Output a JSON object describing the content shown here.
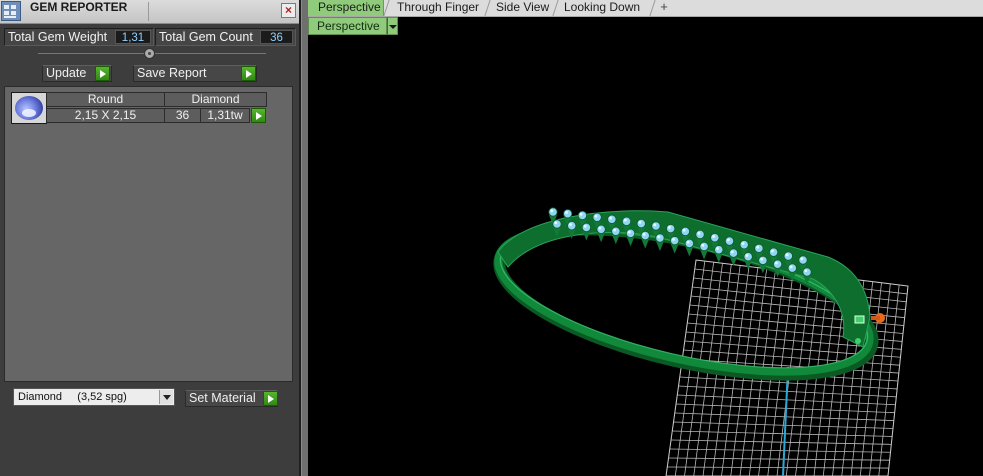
{
  "panel": {
    "title": "GEM REPORTER",
    "total_weight_label": "Total Gem Weight",
    "total_weight_value": "1,31",
    "total_count_label": "Total Gem Count",
    "total_count_value": "36",
    "update_label": "Update",
    "save_report_label": "Save Report",
    "table": {
      "header_shape": "Round",
      "header_material": "Diamond",
      "size": "2,15 X 2,15",
      "count": "36",
      "weight": "1,31tw"
    },
    "material_select_value": "Diamond     (3,52 spg)",
    "set_material_label": "Set Material"
  },
  "tabs": [
    "Perspective",
    "Through Finger",
    "Side View",
    "Looking Down"
  ],
  "add_tab_glyph": "+",
  "viewport": {
    "view_name": "Perspective"
  },
  "colors": {
    "accent_green": "#8fcb7a",
    "ring_green": "#0f7a33",
    "gem_blue": "#8fd6f2",
    "grid": "#bdbdbd"
  }
}
